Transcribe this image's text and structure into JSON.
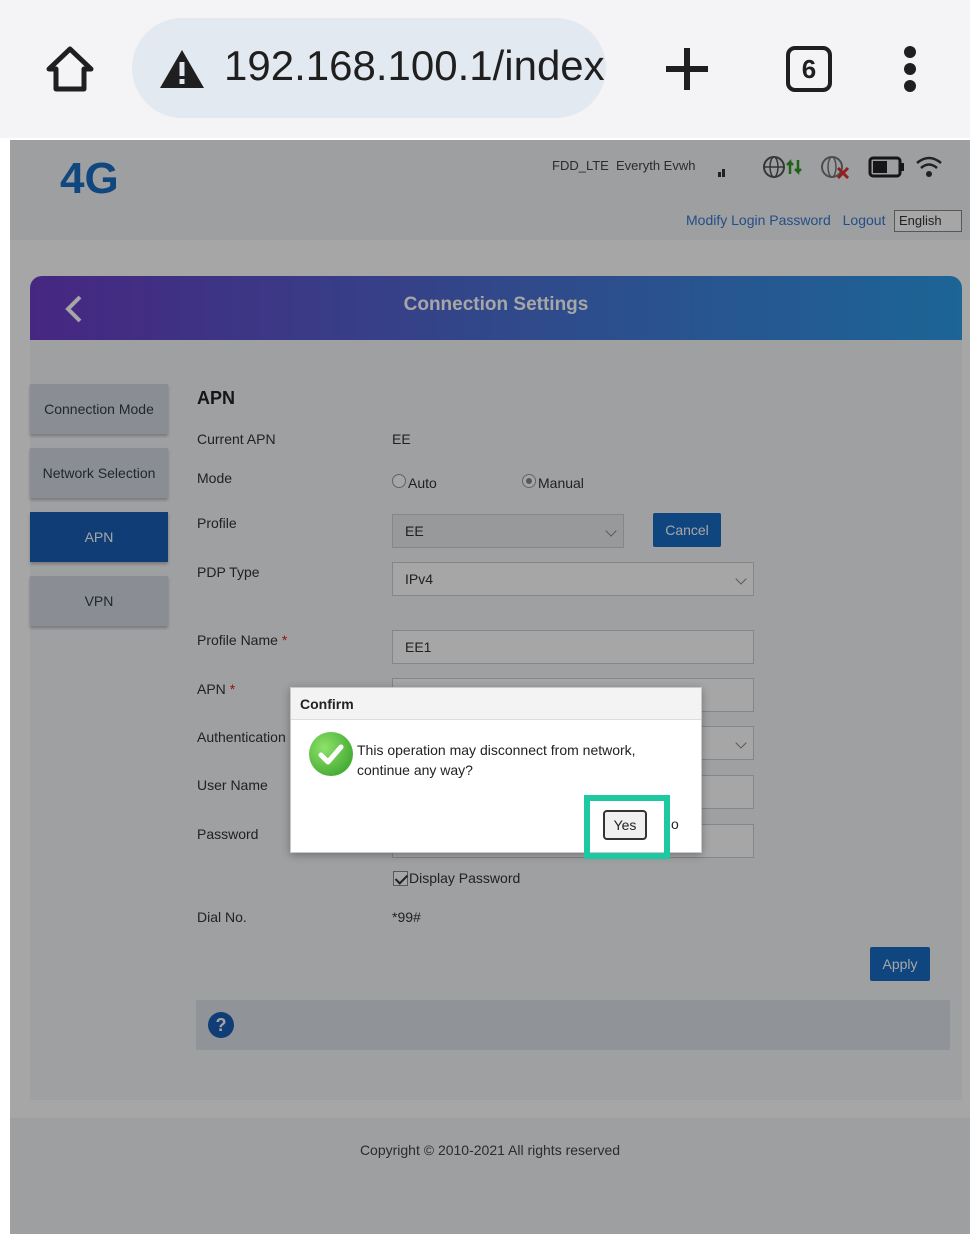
{
  "browser": {
    "url": "192.168.100.1/index",
    "tab_count": "6"
  },
  "header": {
    "logo": "4G",
    "network_type": "FDD_LTE",
    "operator": "Everyth Evwh",
    "links": [
      "Modify Login Password",
      "Logout"
    ],
    "language": "English"
  },
  "banner": {
    "title": "Connection Settings"
  },
  "sidebar": {
    "items": [
      {
        "label": "Connection Mode"
      },
      {
        "label": "Network Selection"
      },
      {
        "label": "APN"
      },
      {
        "label": "VPN"
      }
    ],
    "active": "APN"
  },
  "apn_form": {
    "section_title": "APN",
    "current_apn_label": "Current APN",
    "current_apn_value": "EE",
    "mode_label": "Mode",
    "mode_options": [
      "Auto",
      "Manual"
    ],
    "mode_selected": "Manual",
    "profile_label": "Profile",
    "profile_value": "EE",
    "cancel_label": "Cancel",
    "pdp_type_label": "PDP Type",
    "pdp_type_value": "IPv4",
    "profile_name_label": "Profile Name",
    "profile_name_value": "EE1",
    "apn_label": "APN",
    "authentication_label": "Authentication",
    "user_name_label": "User Name",
    "password_label": "Password",
    "display_password_label": "Display Password",
    "dial_no_label": "Dial No.",
    "dial_no_value": "*99#",
    "apply_label": "Apply",
    "required_mark": "*"
  },
  "footer": {
    "copyright": "Copyright © 2010-2021 All rights reserved"
  },
  "dialog": {
    "title": "Confirm",
    "message": "This operation may disconnect from network, continue any way?",
    "yes_label": "Yes",
    "no_label": "o"
  },
  "colors": {
    "highlight": "#1ec9a2",
    "primary": "#1a5fb4"
  }
}
